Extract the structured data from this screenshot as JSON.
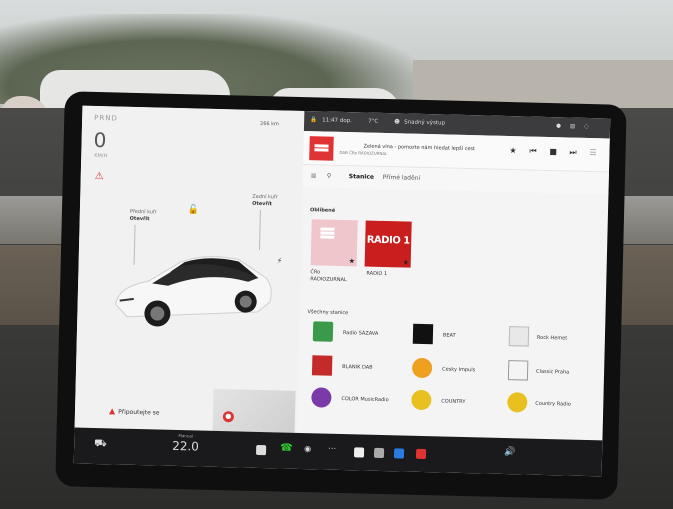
{
  "status": {
    "gear": "PRND",
    "speed": "0",
    "speed_unit": "KM/H",
    "range": "266 km",
    "time": "11:47 dop.",
    "temperature": "7°C",
    "profile": "Snadný výstup"
  },
  "car": {
    "front_trunk_label": "Přední kufr",
    "front_trunk_state": "Otevřít",
    "rear_trunk_label": "Zadní kufr",
    "rear_trunk_state": "Otevřít",
    "warning": "Připoutejte se"
  },
  "player": {
    "title": "Zelená vlna - pomozte nám hledat lepší cest",
    "subtitle": "DAB ČRo RADIOZURNAL",
    "accent": "#e03333"
  },
  "radio": {
    "tabs": [
      "Stanice",
      "Přímé ladění"
    ],
    "favorites_label": "Oblíbené",
    "favorites": [
      "ČRo RADIOZURNAL",
      "RADIO 1"
    ],
    "favorite_logo_text": "RADIO 1",
    "all_label": "Všechny stanice",
    "stations": [
      "Radio SÁZAVA",
      "BEAT",
      "Rock Hemet",
      "BLANIK DAB",
      "Cesky Impuls",
      "Classic Praha",
      "COLOR MusicRadio",
      "COUNTRY",
      "Country Radio"
    ]
  },
  "dock": {
    "temperature": "22.0",
    "temp_label": "Manual"
  }
}
